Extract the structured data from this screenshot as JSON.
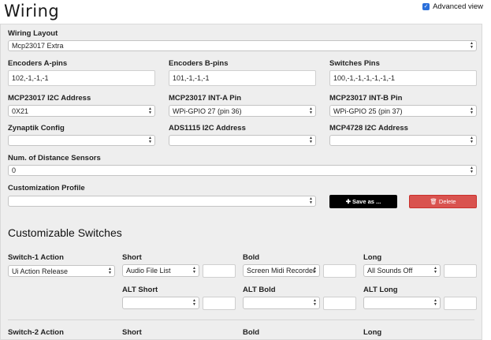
{
  "page": {
    "title": "Wiring"
  },
  "advanced_view": {
    "label": "Advanced view",
    "checked": true
  },
  "wiring_layout": {
    "label": "Wiring Layout",
    "value": "Mcp23017 Extra"
  },
  "encoders_a": {
    "label": "Encoders A-pins",
    "value": "102,-1,-1,-1"
  },
  "encoders_b": {
    "label": "Encoders B-pins",
    "value": "101,-1,-1,-1"
  },
  "switches_pins": {
    "label": "Switches Pins",
    "value": "100,-1,-1,-1,-1,-1,-1"
  },
  "mcp23017_addr": {
    "label": "MCP23017 I2C Address",
    "value": "0X21"
  },
  "mcp23017_inta": {
    "label": "MCP23017 INT-A Pin",
    "value": "WPi-GPIO 27 (pin 36)"
  },
  "mcp23017_intb": {
    "label": "MCP23017 INT-B Pin",
    "value": "WPi-GPIO 25 (pin 37)"
  },
  "zynaptik": {
    "label": "Zynaptik Config",
    "value": ""
  },
  "ads1115": {
    "label": "ADS1115 I2C Address",
    "value": ""
  },
  "mcp4728": {
    "label": "MCP4728 I2C Address",
    "value": ""
  },
  "distance_sensors": {
    "label": "Num. of Distance Sensors",
    "value": "0"
  },
  "customization": {
    "label": "Customization Profile",
    "value": "",
    "save_label": "Save as ...",
    "delete_label": "Delete"
  },
  "customizable_switches": {
    "title": "Customizable Switches",
    "switch1": {
      "action_label": "Switch-1 Action",
      "action_value": "Ui Action Release",
      "short_label": "Short",
      "short_value": "Audio File List",
      "short_param": "",
      "bold_label": "Bold",
      "bold_value": "Screen Midi Recorder",
      "bold_param": "",
      "long_label": "Long",
      "long_value": "All Sounds Off",
      "long_param": "",
      "alt_short_label": "ALT Short",
      "alt_short_value": "",
      "alt_short_param": "",
      "alt_bold_label": "ALT Bold",
      "alt_bold_value": "",
      "alt_bold_param": "",
      "alt_long_label": "ALT Long",
      "alt_long_value": "",
      "alt_long_param": ""
    },
    "switch2": {
      "action_label": "Switch-2 Action",
      "short_label": "Short",
      "bold_label": "Bold",
      "long_label": "Long"
    }
  },
  "colors": {
    "save_button": "#000000",
    "delete_button": "#d9534f",
    "checkbox": "#2a6fdb",
    "panel_bg": "#eeeeee"
  }
}
